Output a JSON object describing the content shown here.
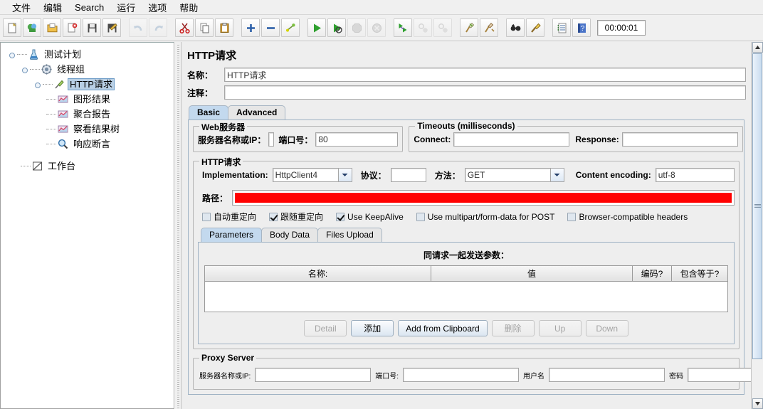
{
  "menu": {
    "items": [
      {
        "label": "文件",
        "name": "menu-file"
      },
      {
        "label": "编辑",
        "name": "menu-edit"
      },
      {
        "label": "Search",
        "name": "menu-search"
      },
      {
        "label": "运行",
        "name": "menu-run"
      },
      {
        "label": "选项",
        "name": "menu-options"
      },
      {
        "label": "帮助",
        "name": "menu-help"
      }
    ]
  },
  "toolbar": {
    "timer": "00:00:01",
    "buttons": [
      {
        "icon": "new-document-icon",
        "enabled": true
      },
      {
        "icon": "templates-icon",
        "enabled": true
      },
      {
        "icon": "open-folder-icon",
        "enabled": true
      },
      {
        "icon": "close-document-icon",
        "enabled": true
      },
      {
        "icon": "save-icon",
        "enabled": true
      },
      {
        "icon": "save-as-icon",
        "enabled": true
      },
      {
        "icon": "undo-icon",
        "enabled": false
      },
      {
        "icon": "redo-icon",
        "enabled": false
      },
      {
        "icon": "cut-icon",
        "enabled": true
      },
      {
        "icon": "copy-icon",
        "enabled": true
      },
      {
        "icon": "paste-icon",
        "enabled": true
      },
      {
        "icon": "expand-all-icon",
        "enabled": true
      },
      {
        "icon": "collapse-all-icon",
        "enabled": true
      },
      {
        "icon": "toggle-icon",
        "enabled": true
      },
      {
        "icon": "start-icon",
        "enabled": true
      },
      {
        "icon": "start-no-pauses-icon",
        "enabled": true
      },
      {
        "icon": "stop-icon",
        "enabled": false
      },
      {
        "icon": "shutdown-icon",
        "enabled": false
      },
      {
        "icon": "start-remote-icon",
        "enabled": true
      },
      {
        "icon": "stop-remote-icon",
        "enabled": false
      },
      {
        "icon": "shutdown-remote-icon",
        "enabled": false
      },
      {
        "icon": "clear-icon",
        "enabled": true
      },
      {
        "icon": "clear-all-icon",
        "enabled": true
      },
      {
        "icon": "search-icon",
        "enabled": true
      },
      {
        "icon": "reset-search-icon",
        "enabled": true
      },
      {
        "icon": "function-helper-icon",
        "enabled": true
      },
      {
        "icon": "help-icon",
        "enabled": true
      }
    ]
  },
  "tree": {
    "nodes": [
      {
        "label": "测试计划",
        "icon": "test-plan-icon",
        "depth": 0,
        "selected": false,
        "expander": true
      },
      {
        "label": "线程组",
        "icon": "thread-group-icon",
        "depth": 1,
        "selected": false,
        "expander": true
      },
      {
        "label": "HTTP请求",
        "icon": "http-request-icon",
        "depth": 2,
        "selected": true,
        "expander": true
      },
      {
        "label": "图形结果",
        "icon": "graph-results-icon",
        "depth": 3,
        "selected": false,
        "expander": false
      },
      {
        "label": "聚合报告",
        "icon": "aggregate-report-icon",
        "depth": 3,
        "selected": false,
        "expander": false
      },
      {
        "label": "察看结果树",
        "icon": "view-results-tree-icon",
        "depth": 3,
        "selected": false,
        "expander": false
      },
      {
        "label": "响应断言",
        "icon": "response-assertion-icon",
        "depth": 3,
        "selected": false,
        "expander": false
      },
      {
        "label": "工作台",
        "icon": "workbench-icon",
        "depth": 0,
        "selected": false,
        "expander": false
      }
    ]
  },
  "panel": {
    "title": "HTTP请求",
    "name_label": "名称：",
    "name_value": "HTTP请求",
    "comment_label": "注释：",
    "comment_value": "",
    "tabs": [
      {
        "label": "Basic",
        "active": true
      },
      {
        "label": "Advanced",
        "active": false
      }
    ],
    "web_server": {
      "title": "Web服务器",
      "server_label": "服务器名称或IP：",
      "server_value": "",
      "server_redacted": true,
      "port_label": "端口号：",
      "port_value": "80"
    },
    "timeouts": {
      "title": "Timeouts (milliseconds)",
      "connect_label": "Connect:",
      "connect_value": "",
      "response_label": "Response:",
      "response_value": ""
    },
    "http_request": {
      "title": "HTTP请求",
      "implementation_label": "Implementation:",
      "implementation_value": "HttpClient4",
      "protocol_label": "协议：",
      "protocol_value": "",
      "method_label": "方法：",
      "method_value": "GET",
      "encoding_label": "Content encoding:",
      "encoding_value": "utf-8",
      "path_label": "路径：",
      "path_value": "",
      "path_redacted": true
    },
    "checkboxes": [
      {
        "label": "自动重定向",
        "checked": false
      },
      {
        "label": "跟随重定向",
        "checked": true
      },
      {
        "label": "Use KeepAlive",
        "checked": true
      },
      {
        "label": "Use multipart/form-data for POST",
        "checked": false
      },
      {
        "label": "Browser-compatible headers",
        "checked": false
      }
    ],
    "param_tabs": [
      {
        "label": "Parameters",
        "active": true
      },
      {
        "label": "Body Data",
        "active": false
      },
      {
        "label": "Files Upload",
        "active": false
      }
    ],
    "params": {
      "caption": "同请求一起发送参数：",
      "columns": [
        "名称:",
        "值",
        "编码?",
        "包含等于?"
      ],
      "rows": [],
      "buttons": [
        {
          "label": "Detail",
          "enabled": false
        },
        {
          "label": "添加",
          "enabled": true
        },
        {
          "label": "Add from Clipboard",
          "enabled": true
        },
        {
          "label": "删除",
          "enabled": false
        },
        {
          "label": "Up",
          "enabled": false
        },
        {
          "label": "Down",
          "enabled": false
        }
      ]
    },
    "proxy": {
      "title": "Proxy Server",
      "server_label": "服务器名称或IP:",
      "server_value": "",
      "port_label": "端口号:",
      "port_value": "",
      "user_label": "用户名",
      "user_value": "",
      "password_label": "密码",
      "password_value": ""
    }
  },
  "colors": {
    "redaction": "#ff0000",
    "selection": "#b8cfe5",
    "active_tab": "#c3d9ee",
    "window_bg": "#eeeeee"
  }
}
